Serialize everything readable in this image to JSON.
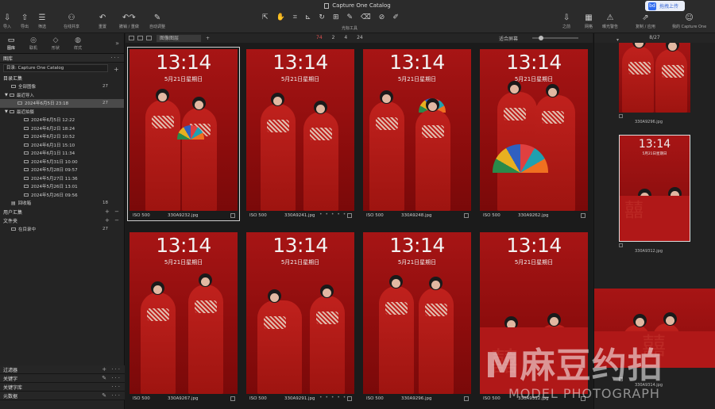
{
  "titlebar": {
    "title": "Capture One Catalog",
    "share_label": "拖拽上传",
    "share_icon": "bd"
  },
  "toolbar": {
    "left": [
      {
        "icon": "⇩",
        "label": "导入"
      },
      {
        "icon": "⇧",
        "label": "导出"
      },
      {
        "icon": "☰",
        "label": "筛选"
      },
      {
        "icon": "⚇",
        "label": "在线共享"
      },
      {
        "icon": "↶",
        "label": "重置"
      },
      {
        "icon": "↶↷",
        "label": "撤销 / 重做"
      },
      {
        "icon": "✎",
        "label": "自动调整"
      }
    ],
    "cursor_tools_label": "光标工具",
    "right": [
      {
        "icon": "⇩",
        "label": "之前"
      },
      {
        "icon": "▦",
        "label": "网格"
      },
      {
        "icon": "⚠",
        "label": "曝光警告"
      },
      {
        "icon": "⇗",
        "label": "复制 / 应用"
      },
      {
        "icon": "☺",
        "label": "我的 Capture One"
      }
    ]
  },
  "left_tabs": [
    {
      "icon": "▭",
      "label": "图库"
    },
    {
      "icon": "◎",
      "label": "联机"
    },
    {
      "icon": "◇",
      "label": "形状"
    },
    {
      "icon": "◍",
      "label": "样式"
    }
  ],
  "library": {
    "header": "图库",
    "catalog_select": "目录: Capture One Catalog",
    "collections_header": "目录汇集",
    "items": [
      {
        "label": "全部图像",
        "count": "27",
        "level": 1
      },
      {
        "label": "最近导入",
        "count": "",
        "level": 0
      },
      {
        "label": "2024年6月5日 23:18",
        "count": "27",
        "level": 2,
        "selected": true
      },
      {
        "label": "最近拍摄",
        "count": "",
        "level": 0
      },
      {
        "label": "2024年6月5日 12:22",
        "count": "",
        "level": 2
      },
      {
        "label": "2024年6月2日 18:24",
        "count": "",
        "level": 2
      },
      {
        "label": "2024年6月2日 10:52",
        "count": "",
        "level": 2
      },
      {
        "label": "2024年6月1日 15:10",
        "count": "",
        "level": 2
      },
      {
        "label": "2024年6月1日 11:34",
        "count": "",
        "level": 2
      },
      {
        "label": "2024年5月31日 10:00",
        "count": "",
        "level": 2
      },
      {
        "label": "2024年5月28日 09:57",
        "count": "",
        "level": 2
      },
      {
        "label": "2024年5月27日 11:36",
        "count": "",
        "level": 2
      },
      {
        "label": "2024年5月26日 13:01",
        "count": "",
        "level": 2
      },
      {
        "label": "2024年5月26日 09:56",
        "count": "",
        "level": 2
      },
      {
        "label": "回收箱",
        "count": "18",
        "level": 1
      }
    ],
    "user_collections": "用户汇集",
    "folders": "文件夹",
    "in_catalog": "在目录中",
    "in_catalog_count": "27"
  },
  "lower_panels": [
    "过滤器",
    "关键字",
    "关键字库",
    "元数据"
  ],
  "grid_toolbar": {
    "view_select": "图像图层",
    "count_label": "74",
    "count_b": "2",
    "count_c": "4",
    "count_d": "24",
    "fit": "适合屏幕"
  },
  "photo_overlay": {
    "time": "13:14",
    "date": "5月21日星期日"
  },
  "photos": [
    {
      "iso": "ISO 500",
      "name": "330A9232.jpg",
      "dots": ""
    },
    {
      "iso": "ISO 500",
      "name": "330A9241.jpg",
      "dots": "• • • • •"
    },
    {
      "iso": "ISO 500",
      "name": "330A9248.jpg",
      "dots": ""
    },
    {
      "iso": "ISO 500",
      "name": "330A9262.jpg",
      "dots": ""
    },
    {
      "iso": "ISO 500",
      "name": "330A9267.jpg",
      "dots": ""
    },
    {
      "iso": "ISO 500",
      "name": "330A9291.jpg",
      "dots": "• • • • •"
    },
    {
      "iso": "ISO 500",
      "name": "330A9296.jpg",
      "dots": ""
    },
    {
      "iso": "ISO 500",
      "name": "330A9312.jpg",
      "dots": ""
    }
  ],
  "right_strip": {
    "counter": "8/27",
    "thumbs": [
      {
        "name": "330A9296.jpg"
      },
      {
        "name": "330A9312.jpg"
      },
      {
        "name": "330A9314.jpg"
      }
    ]
  },
  "watermark": {
    "big": "M麻豆约拍",
    "sub": "MODEL PHOTOGRAPH"
  }
}
